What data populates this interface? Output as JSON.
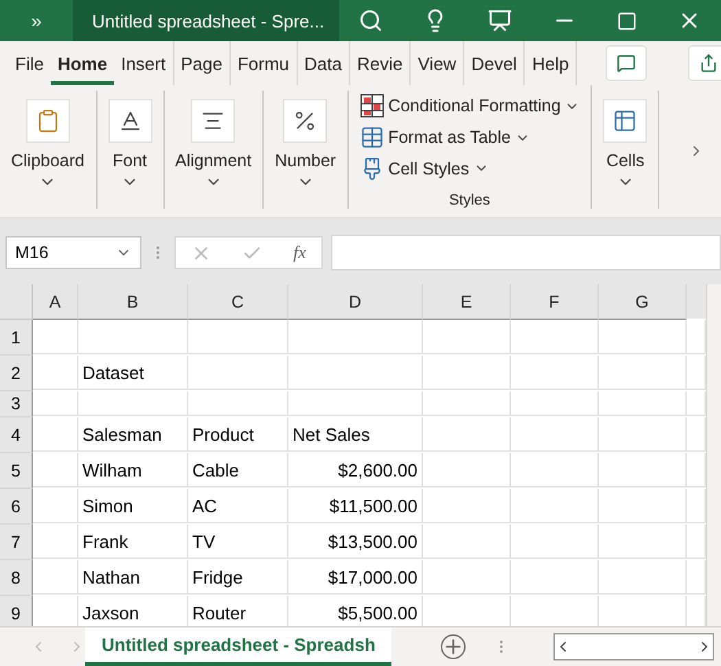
{
  "title_bar": {
    "overflow": "»",
    "title": "Untitled spreadsheet - Spre..."
  },
  "ribbon_tabs": [
    {
      "label": "File",
      "selected": false
    },
    {
      "label": "Home",
      "selected": true
    },
    {
      "label": "Insert",
      "selected": false
    },
    {
      "label": "Page",
      "selected": false
    },
    {
      "label": "Formu",
      "selected": false
    },
    {
      "label": "Data",
      "selected": false
    },
    {
      "label": "Revie",
      "selected": false
    },
    {
      "label": "View",
      "selected": false
    },
    {
      "label": "Devel",
      "selected": false
    },
    {
      "label": "Help",
      "selected": false
    }
  ],
  "ribbon_groups": [
    {
      "kind": "button",
      "label": "Clipboard"
    },
    {
      "kind": "button",
      "label": "Font"
    },
    {
      "kind": "button",
      "label": "Alignment"
    },
    {
      "kind": "button",
      "label": "Number"
    },
    {
      "kind": "list",
      "label": "Styles",
      "items": [
        {
          "label": "Conditional Formatting"
        },
        {
          "label": "Format as Table"
        },
        {
          "label": "Cell Styles"
        }
      ]
    },
    {
      "kind": "button",
      "label": "Cells"
    }
  ],
  "formula_bar": {
    "name_box": "M16",
    "function_label": "fx"
  },
  "columns": [
    "A",
    "B",
    "C",
    "D",
    "E",
    "F",
    "G"
  ],
  "rows": [
    {
      "number": "1",
      "kind": "text"
    },
    {
      "number": "2",
      "kind": "text",
      "b": "Dataset"
    },
    {
      "number": "3",
      "kind": "blank"
    },
    {
      "number": "4",
      "kind": "text",
      "b": "Salesman",
      "c": "Product",
      "d": "Net Sales"
    },
    {
      "number": "5",
      "kind": "record",
      "b": "Wilham",
      "c": "Cable",
      "d": "$2,600.00"
    },
    {
      "number": "6",
      "kind": "record",
      "b": "Simon",
      "c": "AC",
      "d": "$11,500.00"
    },
    {
      "number": "7",
      "kind": "record",
      "b": "Frank",
      "c": "TV",
      "d": "$13,500.00"
    },
    {
      "number": "8",
      "kind": "record",
      "b": "Nathan",
      "c": "Fridge",
      "d": "$17,000.00"
    },
    {
      "number": "9",
      "kind": "record",
      "b": "Jaxson",
      "c": "Router",
      "d": "$5,500.00"
    }
  ],
  "sheet_tabs": [
    {
      "label": "Untitled spreadsheet - Spreadsh",
      "selected": true
    }
  ]
}
